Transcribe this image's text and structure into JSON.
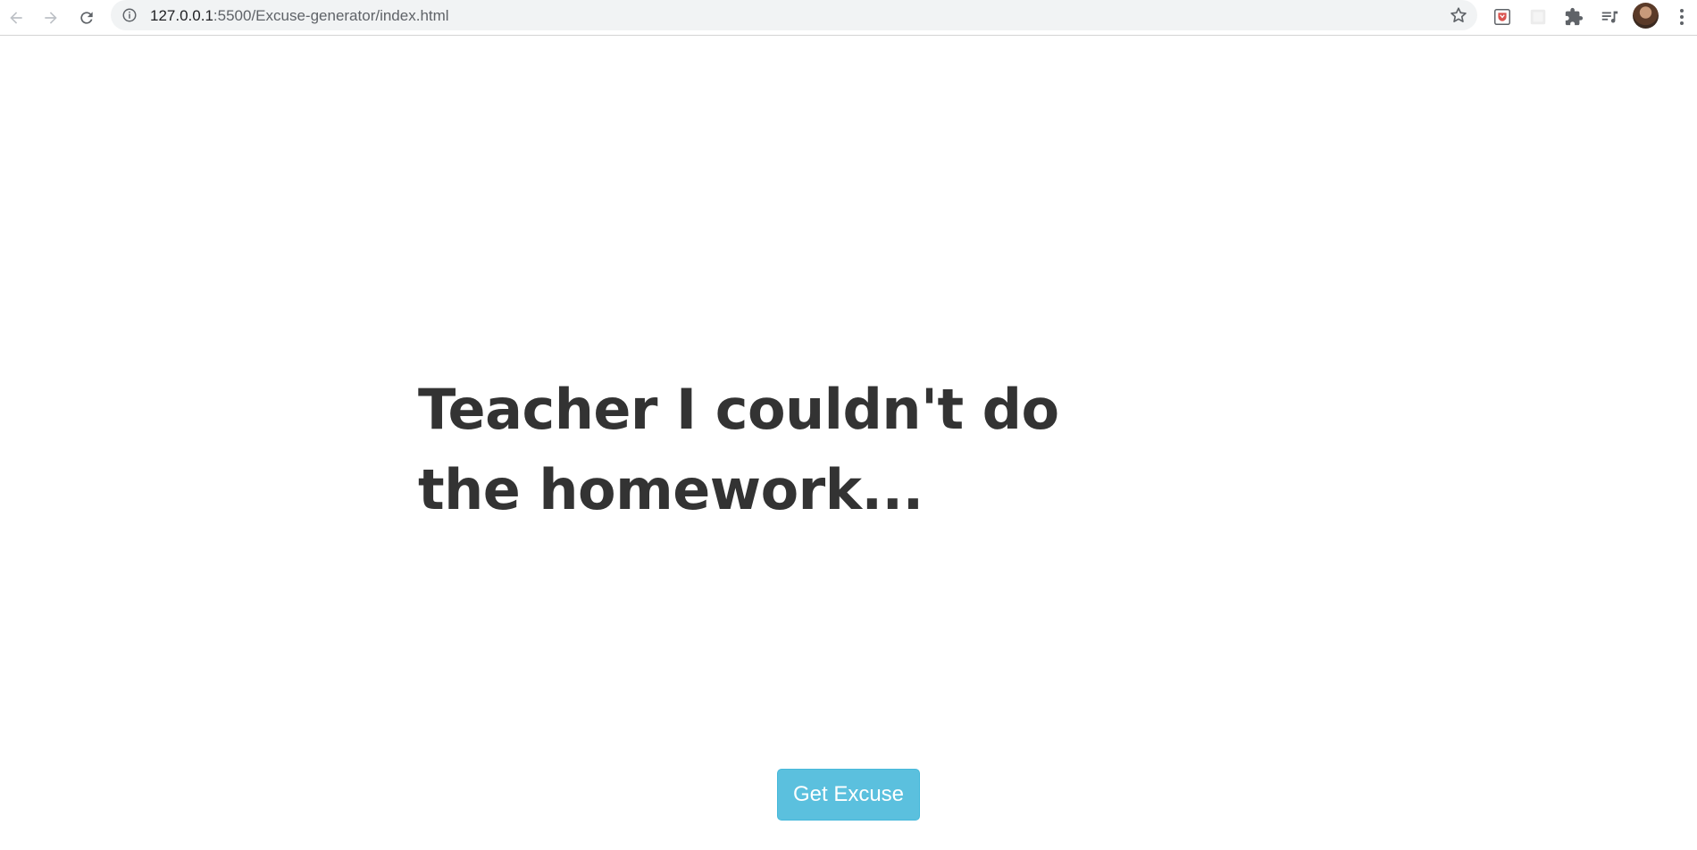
{
  "browser": {
    "url_host": "127.0.0.1",
    "url_rest": ":5500/Excuse-generator/index.html",
    "icons": {
      "back": "back-arrow-icon",
      "forward": "forward-arrow-icon",
      "reload": "reload-icon",
      "site_info": "info-icon",
      "bookmark": "star-icon",
      "extensions": "puzzle-icon",
      "media": "media-queue-icon",
      "menu": "kebab-menu-icon"
    }
  },
  "main": {
    "excuse_text": "Teacher I couldn't do the homework...",
    "button_label": "Get Excuse"
  },
  "colors": {
    "heading": "#333333",
    "button_bg": "#5bc0de",
    "button_text": "#ffffff"
  }
}
